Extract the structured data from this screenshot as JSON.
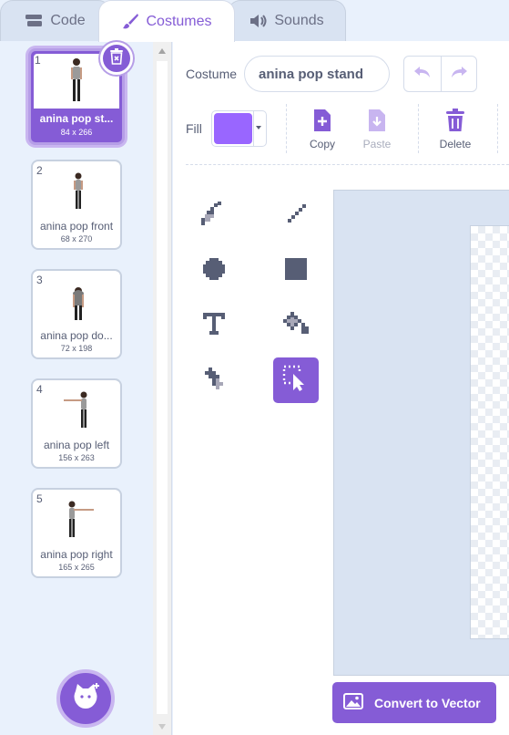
{
  "tabs": [
    {
      "label": "Code",
      "icon": "code-blocks-icon",
      "active": false
    },
    {
      "label": "Costumes",
      "icon": "paintbrush-icon",
      "active": true
    },
    {
      "label": "Sounds",
      "icon": "speaker-icon",
      "active": false
    }
  ],
  "costumes": [
    {
      "number": "1",
      "name": "anina pop st...",
      "size": "84 x 266",
      "selected": true
    },
    {
      "number": "2",
      "name": "anina pop front",
      "size": "68 x 270",
      "selected": false
    },
    {
      "number": "3",
      "name": "anina pop do...",
      "size": "72 x 198",
      "selected": false
    },
    {
      "number": "4",
      "name": "anina pop left",
      "size": "156 x 263",
      "selected": false
    },
    {
      "number": "5",
      "name": "anina pop right",
      "size": "165 x 265",
      "selected": false
    }
  ],
  "editor": {
    "costume_label": "Costume",
    "costume_name": "anina pop stand",
    "fill_label": "Fill",
    "fill_color": "#9966ff",
    "actions": {
      "copy": "Copy",
      "paste": "Paste",
      "delete": "Delete"
    },
    "convert_label": "Convert to Vector"
  },
  "tools": [
    {
      "name": "brush",
      "icon": "brush-icon",
      "active": false
    },
    {
      "name": "line",
      "icon": "line-icon",
      "active": false
    },
    {
      "name": "circle",
      "icon": "circle-icon",
      "active": false
    },
    {
      "name": "rectangle",
      "icon": "rectangle-icon",
      "active": false
    },
    {
      "name": "text",
      "icon": "text-icon",
      "active": false
    },
    {
      "name": "fill",
      "icon": "fill-bucket-icon",
      "active": false
    },
    {
      "name": "eraser",
      "icon": "eraser-icon",
      "active": false
    },
    {
      "name": "select",
      "icon": "select-icon",
      "active": true
    }
  ],
  "colors": {
    "accent": "#855cd6",
    "fill": "#9966ff",
    "panel": "#e9f1fc",
    "text": "#575e75"
  }
}
